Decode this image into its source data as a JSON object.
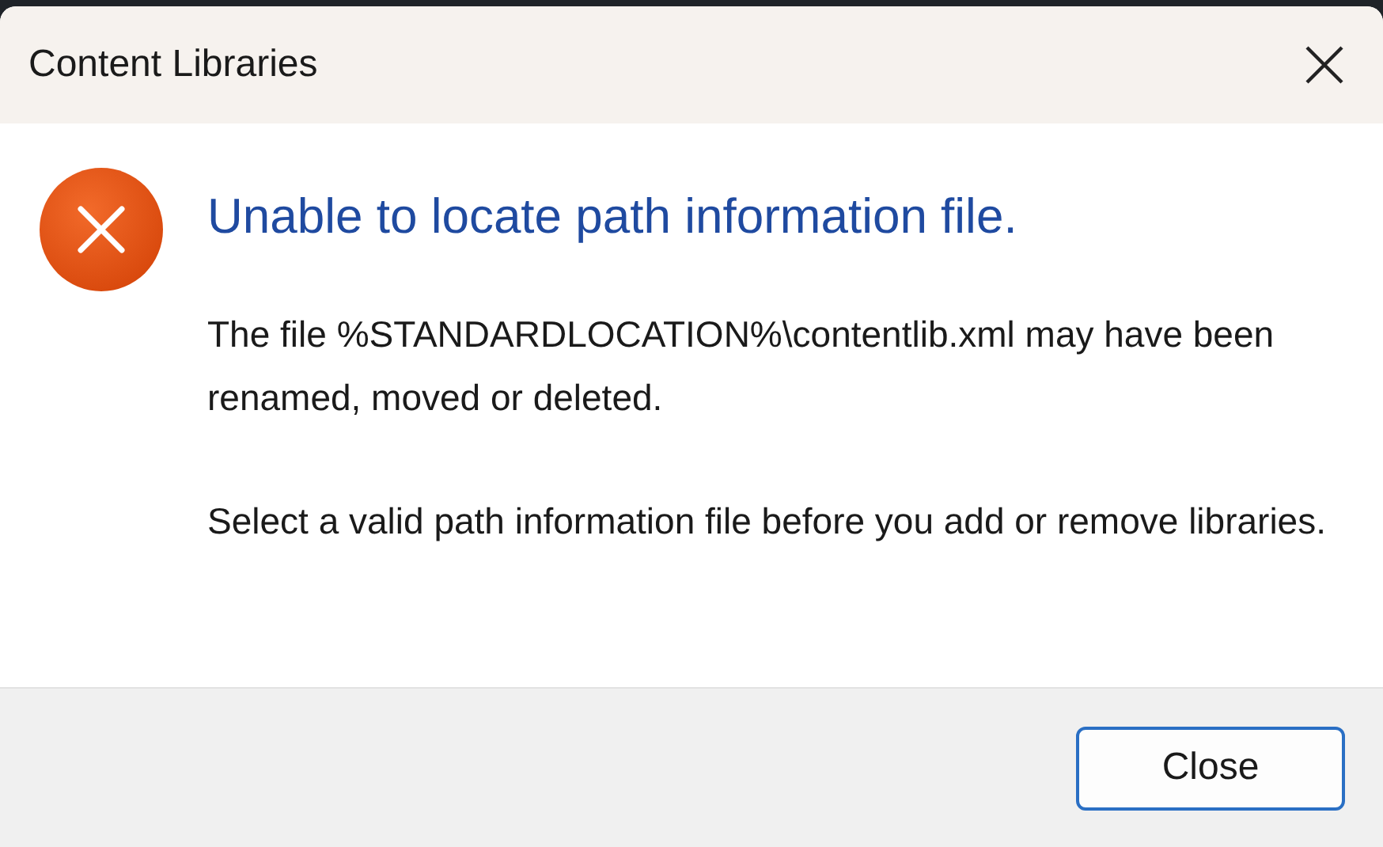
{
  "window": {
    "title": "Content Libraries"
  },
  "message": {
    "heading": "Unable to locate path information file.",
    "paragraphs": [
      "The file %STANDARDLOCATION%\\contentlib.xml may have been renamed, moved or deleted.",
      "Select a valid path information file before you add or remove libraries."
    ]
  },
  "buttons": [
    {
      "label": "Close",
      "default": true
    }
  ]
}
